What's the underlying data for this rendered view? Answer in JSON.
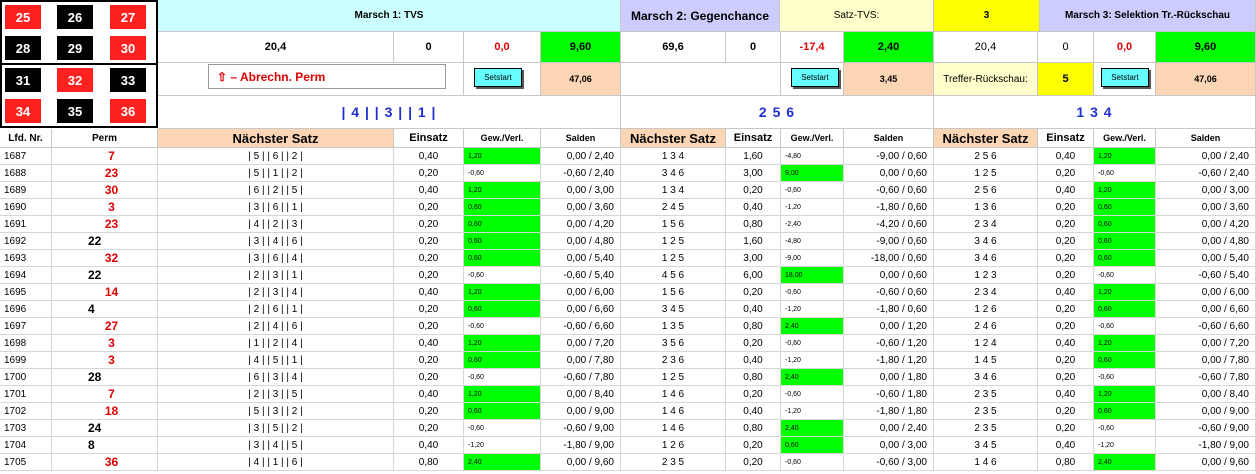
{
  "roulette_board": [
    {
      "n": "25",
      "color": "red"
    },
    {
      "n": "26",
      "color": "black"
    },
    {
      "n": "27",
      "color": "red"
    },
    {
      "n": "28",
      "color": "black"
    },
    {
      "n": "29",
      "color": "black"
    },
    {
      "n": "30",
      "color": "red"
    },
    {
      "n": "31",
      "color": "black"
    },
    {
      "n": "32",
      "color": "red"
    },
    {
      "n": "33",
      "color": "black"
    },
    {
      "n": "34",
      "color": "red"
    },
    {
      "n": "35",
      "color": "black"
    },
    {
      "n": "36",
      "color": "red"
    }
  ],
  "march1": {
    "title": "Marsch 1: TVS",
    "stat1": "20,4",
    "stat2": "0",
    "stat3": "0,0",
    "stat4": "9,60",
    "abrechn_label": "⇧ – Abrechn. Perm",
    "setstart_label": "Setstart",
    "total": "47,06",
    "sequence": "| 4 | | 3 | | 1 |"
  },
  "march2": {
    "title": "Marsch 2: Gegenchance",
    "stat1": "69,6",
    "stat2": "0",
    "stat3": "-17,4",
    "stat4": "2,40",
    "setstart_label": "Setstart",
    "total": "3,45",
    "sequence": "2 5 6",
    "satz_label": "Satz-TVS:",
    "satz_value": "3"
  },
  "march3": {
    "title": "Marsch 3: Selektion Tr.-Rückschau",
    "stat1": "20,4",
    "stat2": "0",
    "stat3": "0,0",
    "stat4": "9,60",
    "treffer_label": "Treffer-Rückschau:",
    "treffer_value": "5",
    "setstart_label": "Setstart",
    "total": "47,06",
    "sequence": "1 3 4"
  },
  "headers": {
    "lfd": "Lfd. Nr.",
    "perm": "Perm",
    "naechster": "Nächster Satz",
    "einsatz": "Einsatz",
    "gew": "Gew./Verl.",
    "salden": "Salden"
  },
  "rows": [
    {
      "nr": "1687",
      "perm": "7",
      "pc": "red",
      "s1": "| 5 | | 6 | | 2 |",
      "e1": "0,40",
      "g1": "1,20",
      "w1": true,
      "sa1": "0,00 / 2,40",
      "s2": "1 3 4",
      "e2": "1,60",
      "g2": "-4,80",
      "w2": false,
      "sa2": "-9,00 / 0,60",
      "s3": "2 5 6",
      "e3": "0,40",
      "g3": "1,20",
      "w3": true,
      "sa3": "0,00 / 2,40"
    },
    {
      "nr": "1688",
      "perm": "23",
      "pc": "red",
      "s1": "| 5 | | 1 | | 2 |",
      "e1": "0,20",
      "g1": "-0,60",
      "w1": false,
      "sa1": "-0,60 / 2,40",
      "s2": "3 4 6",
      "e2": "3,00",
      "g2": "9,00",
      "w2": true,
      "sa2": "0,00 / 0,60",
      "s3": "1 2 5",
      "e3": "0,20",
      "g3": "-0,60",
      "w3": false,
      "sa3": "-0,60 / 2,40"
    },
    {
      "nr": "1689",
      "perm": "30",
      "pc": "red",
      "s1": "| 6 | | 2 | | 5 |",
      "e1": "0,40",
      "g1": "1,20",
      "w1": true,
      "sa1": "0,00 / 3,00",
      "s2": "1 3 4",
      "e2": "0,20",
      "g2": "-0,60",
      "w2": false,
      "sa2": "-0,60 / 0,60",
      "s3": "2 5 6",
      "e3": "0,40",
      "g3": "1,20",
      "w3": true,
      "sa3": "0,00 / 3,00"
    },
    {
      "nr": "1690",
      "perm": "3",
      "pc": "red",
      "s1": "| 3 | | 6 | | 1 |",
      "e1": "0,20",
      "g1": "0,60",
      "w1": true,
      "sa1": "0,00 / 3,60",
      "s2": "2 4 5",
      "e2": "0,40",
      "g2": "-1,20",
      "w2": false,
      "sa2": "-1,80 / 0,60",
      "s3": "1 3 6",
      "e3": "0,20",
      "g3": "0,60",
      "w3": true,
      "sa3": "0,00 / 3,60"
    },
    {
      "nr": "1691",
      "perm": "23",
      "pc": "red",
      "s1": "| 4 | | 2 | | 3 |",
      "e1": "0,20",
      "g1": "0,60",
      "w1": true,
      "sa1": "0,00 / 4,20",
      "s2": "1 5 6",
      "e2": "0,80",
      "g2": "-2,40",
      "w2": false,
      "sa2": "-4,20 / 0,60",
      "s3": "2 3 4",
      "e3": "0,20",
      "g3": "0,60",
      "w3": true,
      "sa3": "0,00 / 4,20"
    },
    {
      "nr": "1692",
      "perm": "22",
      "pc": "black",
      "s1": "| 3 | | 4 | | 6 |",
      "e1": "0,20",
      "g1": "0,60",
      "w1": true,
      "sa1": "0,00 / 4,80",
      "s2": "1 2 5",
      "e2": "1,60",
      "g2": "-4,80",
      "w2": false,
      "sa2": "-9,00 / 0,60",
      "s3": "3 4 6",
      "e3": "0,20",
      "g3": "0,60",
      "w3": true,
      "sa3": "0,00 / 4,80"
    },
    {
      "nr": "1693",
      "perm": "32",
      "pc": "red",
      "s1": "| 3 | | 6 | | 4 |",
      "e1": "0,20",
      "g1": "0,60",
      "w1": true,
      "sa1": "0,00 / 5,40",
      "s2": "1 2 5",
      "e2": "3,00",
      "g2": "-9,00",
      "w2": false,
      "sa2": "-18,00 / 0,60",
      "s3": "3 4 6",
      "e3": "0,20",
      "g3": "0,60",
      "w3": true,
      "sa3": "0,00 / 5,40"
    },
    {
      "nr": "1694",
      "perm": "22",
      "pc": "black",
      "s1": "| 2 | | 3 | | 1 |",
      "e1": "0,20",
      "g1": "-0,60",
      "w1": false,
      "sa1": "-0,60 / 5,40",
      "s2": "4 5 6",
      "e2": "6,00",
      "g2": "18,00",
      "w2": true,
      "sa2": "0,00 / 0,60",
      "s3": "1 2 3",
      "e3": "0,20",
      "g3": "-0,60",
      "w3": false,
      "sa3": "-0,60 / 5,40"
    },
    {
      "nr": "1695",
      "perm": "14",
      "pc": "red",
      "s1": "| 2 | | 3 | | 4 |",
      "e1": "0,40",
      "g1": "1,20",
      "w1": true,
      "sa1": "0,00 / 6,00",
      "s2": "1 5 6",
      "e2": "0,20",
      "g2": "-0,60",
      "w2": false,
      "sa2": "-0,60 / 0,60",
      "s3": "2 3 4",
      "e3": "0,40",
      "g3": "1,20",
      "w3": true,
      "sa3": "0,00 / 6,00"
    },
    {
      "nr": "1696",
      "perm": "4",
      "pc": "black",
      "s1": "| 2 | | 6 | | 1 |",
      "e1": "0,20",
      "g1": "0,60",
      "w1": true,
      "sa1": "0,00 / 6,60",
      "s2": "3 4 5",
      "e2": "0,40",
      "g2": "-1,20",
      "w2": false,
      "sa2": "-1,80 / 0,60",
      "s3": "1 2 6",
      "e3": "0,20",
      "g3": "0,60",
      "w3": true,
      "sa3": "0,00 / 6,60"
    },
    {
      "nr": "1697",
      "perm": "27",
      "pc": "red",
      "s1": "| 2 | | 4 | | 6 |",
      "e1": "0,20",
      "g1": "-0,60",
      "w1": false,
      "sa1": "-0,60 / 6,60",
      "s2": "1 3 5",
      "e2": "0,80",
      "g2": "2,40",
      "w2": true,
      "sa2": "0,00 / 1,20",
      "s3": "2 4 6",
      "e3": "0,20",
      "g3": "-0,60",
      "w3": false,
      "sa3": "-0,60 / 6,60"
    },
    {
      "nr": "1698",
      "perm": "3",
      "pc": "red",
      "s1": "| 1 | | 2 | | 4 |",
      "e1": "0,40",
      "g1": "1,20",
      "w1": true,
      "sa1": "0,00 / 7,20",
      "s2": "3 5 6",
      "e2": "0,20",
      "g2": "-0,60",
      "w2": false,
      "sa2": "-0,60 / 1,20",
      "s3": "1 2 4",
      "e3": "0,40",
      "g3": "1,20",
      "w3": true,
      "sa3": "0,00 / 7,20"
    },
    {
      "nr": "1699",
      "perm": "3",
      "pc": "red",
      "s1": "| 4 | | 5 | | 1 |",
      "e1": "0,20",
      "g1": "0,60",
      "w1": true,
      "sa1": "0,00 / 7,80",
      "s2": "2 3 6",
      "e2": "0,40",
      "g2": "-1,20",
      "w2": false,
      "sa2": "-1,80 / 1,20",
      "s3": "1 4 5",
      "e3": "0,20",
      "g3": "0,60",
      "w3": true,
      "sa3": "0,00 / 7,80"
    },
    {
      "nr": "1700",
      "perm": "28",
      "pc": "black",
      "s1": "| 6 | | 3 | | 4 |",
      "e1": "0,20",
      "g1": "-0,60",
      "w1": false,
      "sa1": "-0,60 / 7,80",
      "s2": "1 2 5",
      "e2": "0,80",
      "g2": "2,40",
      "w2": true,
      "sa2": "0,00 / 1,80",
      "s3": "3 4 6",
      "e3": "0,20",
      "g3": "-0,60",
      "w3": false,
      "sa3": "-0,60 / 7,80"
    },
    {
      "nr": "1701",
      "perm": "7",
      "pc": "red",
      "s1": "| 2 | | 3 | | 5 |",
      "e1": "0,40",
      "g1": "1,20",
      "w1": true,
      "sa1": "0,00 / 8,40",
      "s2": "1 4 6",
      "e2": "0,20",
      "g2": "-0,60",
      "w2": false,
      "sa2": "-0,60 / 1,80",
      "s3": "2 3 5",
      "e3": "0,40",
      "g3": "1,20",
      "w3": true,
      "sa3": "0,00 / 8,40"
    },
    {
      "nr": "1702",
      "perm": "18",
      "pc": "red",
      "s1": "| 5 | | 3 | | 2 |",
      "e1": "0,20",
      "g1": "0,60",
      "w1": true,
      "sa1": "0,00 / 9,00",
      "s2": "1 4 6",
      "e2": "0,40",
      "g2": "-1,20",
      "w2": false,
      "sa2": "-1,80 / 1,80",
      "s3": "2 3 5",
      "e3": "0,20",
      "g3": "0,60",
      "w3": true,
      "sa3": "0,00 / 9,00"
    },
    {
      "nr": "1703",
      "perm": "24",
      "pc": "black",
      "s1": "| 3 | | 5 | | 2 |",
      "e1": "0,20",
      "g1": "-0,60",
      "w1": false,
      "sa1": "-0,60 / 9,00",
      "s2": "1 4 6",
      "e2": "0,80",
      "g2": "2,40",
      "w2": true,
      "sa2": "0,00 / 2,40",
      "s3": "2 3 5",
      "e3": "0,20",
      "g3": "-0,60",
      "w3": false,
      "sa3": "-0,60 / 9,00"
    },
    {
      "nr": "1704",
      "perm": "8",
      "pc": "black",
      "s1": "| 3 | | 4 | | 5 |",
      "e1": "0,40",
      "g1": "-1,20",
      "w1": false,
      "sa1": "-1,80 / 9,00",
      "s2": "1 2 6",
      "e2": "0,20",
      "g2": "0,60",
      "w2": true,
      "sa2": "0,00 / 3,00",
      "s3": "3 4 5",
      "e3": "0,40",
      "g3": "-1,20",
      "w3": false,
      "sa3": "-1,80 / 9,00"
    },
    {
      "nr": "1705",
      "perm": "36",
      "pc": "red",
      "s1": "| 4 | | 1 | | 6 |",
      "e1": "0,80",
      "g1": "2,40",
      "w1": true,
      "sa1": "0,00 / 9,60",
      "s2": "2 3 5",
      "e2": "0,20",
      "g2": "-0,60",
      "w2": false,
      "sa2": "-0,60 / 3,00",
      "s3": "1 4 6",
      "e3": "0,80",
      "g3": "2,40",
      "w3": true,
      "sa3": "0,00 / 9,60"
    }
  ]
}
